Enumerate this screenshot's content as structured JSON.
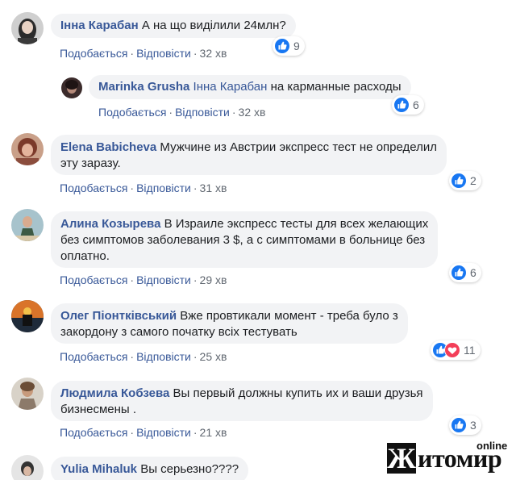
{
  "colors": {
    "link": "#385898",
    "bubble": "#f2f3f5",
    "like": "#1877f2",
    "love": "#f33e58",
    "meta": "#606770"
  },
  "action_labels": {
    "like": "Подобається",
    "reply": "Відповісти",
    "separator": "·"
  },
  "comments": [
    {
      "author": "Інна Карабан",
      "lines": [
        "А на що виділили 24млн?"
      ],
      "time": "32 хв",
      "reactions": [
        "like"
      ],
      "count": "9"
    },
    {
      "author": "Marinka Grusha",
      "mention": "Інна Карабан",
      "lines": [
        "на карманные расходы"
      ],
      "time": "32 хв",
      "reactions": [
        "like"
      ],
      "count": "6"
    },
    {
      "author": "Elena Babicheva",
      "lines": [
        "Мужчине из Австрии экспресс тест не определил",
        "эту заразу."
      ],
      "time": "31 хв",
      "reactions": [
        "like"
      ],
      "count": "2"
    },
    {
      "author": "Алина Козырева",
      "lines": [
        "В Израиле экспресс тесты для всех желающих",
        "без симптомов заболевания 3 $, а с симптомами в больнице без",
        "оплатно."
      ],
      "time": "29 хв",
      "reactions": [
        "like"
      ],
      "count": "6"
    },
    {
      "author": "Олег Піонтківський",
      "lines": [
        "Вже провтикали момент - треба було з",
        "закордону з самого початку всіх тестувать"
      ],
      "time": "25 хв",
      "reactions": [
        "like",
        "love"
      ],
      "count": "11"
    },
    {
      "author": "Людмила Кобзева",
      "lines": [
        "Вы первый должны купить их и ваши друзья",
        "бизнесмены ."
      ],
      "time": "21 хв",
      "reactions": [
        "like"
      ],
      "count": "3"
    },
    {
      "author": "Yulia Mihaluk",
      "lines": [
        "Вы серьезно????"
      ]
    }
  ],
  "watermark": {
    "first_letter": "Ж",
    "rest": "итомир",
    "suffix": "online"
  }
}
